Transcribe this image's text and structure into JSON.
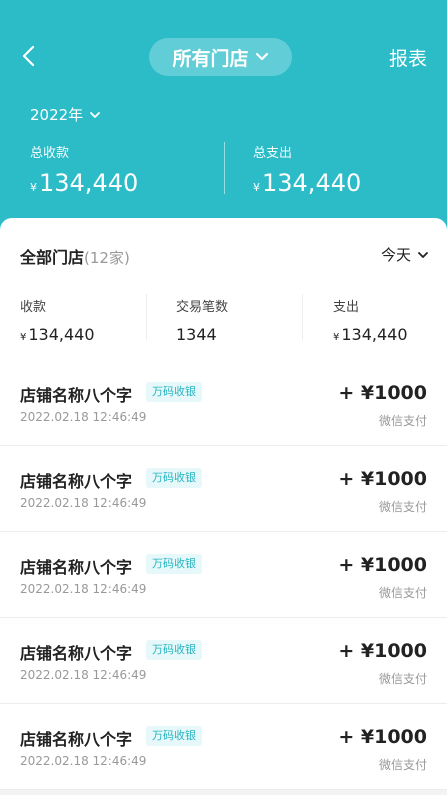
{
  "header": {
    "store_selector": "所有门店",
    "report_label": "报表",
    "year": "2022年",
    "total_income_label": "总收款",
    "total_income_currency": "¥",
    "total_income_value": "134,440",
    "total_expense_label": "总支出",
    "total_expense_currency": "¥",
    "total_expense_value": "134,440"
  },
  "summary": {
    "title": "全部门店",
    "count": "(12家)",
    "date_filter": "今天",
    "income_label": "收款",
    "income_currency": "¥",
    "income_value": "134,440",
    "tx_label": "交易笔数",
    "tx_value": "1344",
    "expense_label": "支出",
    "expense_currency": "¥",
    "expense_value": "134,440"
  },
  "transactions": [
    {
      "name": "店铺名称八个字",
      "tag": "万码收银",
      "time": "2022.02.18 12:46:49",
      "amount": "+ ¥1000",
      "method": "微信支付"
    },
    {
      "name": "店铺名称八个字",
      "tag": "万码收银",
      "time": "2022.02.18 12:46:49",
      "amount": "+ ¥1000",
      "method": "微信支付"
    },
    {
      "name": "店铺名称八个字",
      "tag": "万码收银",
      "time": "2022.02.18 12:46:49",
      "amount": "+ ¥1000",
      "method": "微信支付"
    },
    {
      "name": "店铺名称八个字",
      "tag": "万码收银",
      "time": "2022.02.18 12:46:49",
      "amount": "+ ¥1000",
      "method": "微信支付"
    },
    {
      "name": "店铺名称八个字",
      "tag": "万码收银",
      "time": "2022.02.18 12:46:49",
      "amount": "+ ¥1000",
      "method": "微信支付"
    }
  ],
  "colors": {
    "primary": "#2cbcc8",
    "tag_bg": "#e6f8fa",
    "tag_text": "#27b4c0"
  },
  "icons": {
    "back": "back-arrow-icon",
    "dropdown": "chevron-down-icon"
  }
}
